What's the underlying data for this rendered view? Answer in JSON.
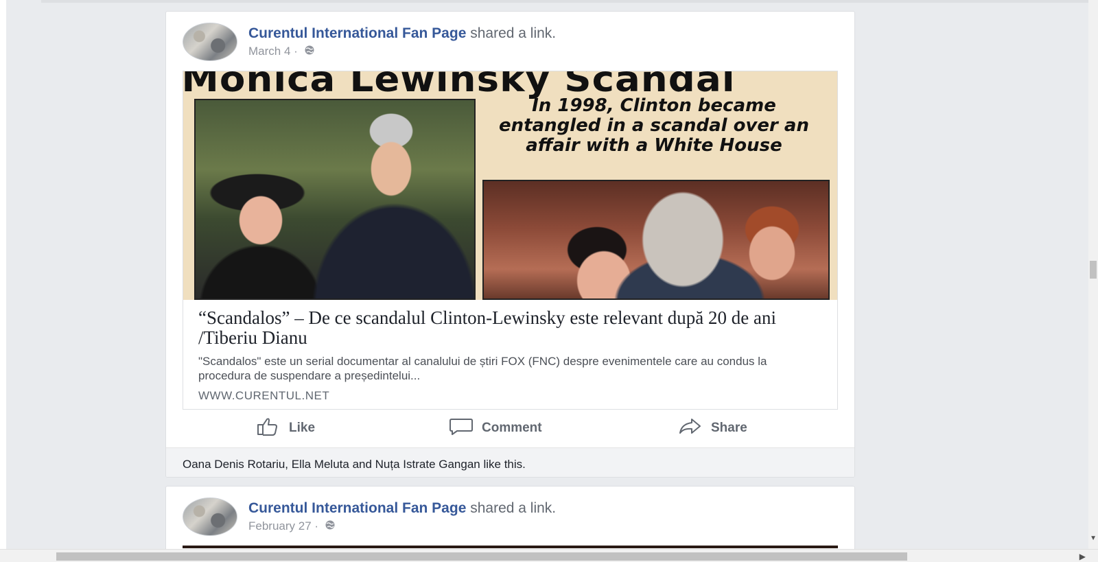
{
  "posts": [
    {
      "author": "Curentul International Fan Page",
      "action": "shared a link.",
      "date": "March 4",
      "date_separator": "·",
      "link": {
        "image_banner_title": "Monica Lewinsky Scandal",
        "image_caption": "In 1998, Clinton became entangled in a scandal over an affair with a White House",
        "headline": "“Scandalos” – De ce scandalul Clinton-Lewinsky este relevant după 20 de ani /Tiberiu Dianu",
        "description": "\"Scandalos\" este un serial documentar al canalului de știri FOX (FNC) despre evenimentele care au condus la procedura de suspendare a președintelui...",
        "domain": "WWW.CURENTUL.NET"
      },
      "actions": {
        "like": "Like",
        "comment": "Comment",
        "share": "Share"
      },
      "likes_summary": "Oana Denis Rotariu, Ella Meluta and Nuța Istrate Gangan like this."
    },
    {
      "author": "Curentul International Fan Page",
      "action": "shared a link.",
      "date": "February 27",
      "date_separator": "·"
    }
  ],
  "icons": {
    "audience": "globe-icon",
    "like": "thumbs-up-icon",
    "comment": "speech-bubble-icon",
    "share": "share-arrow-icon"
  },
  "colors": {
    "author_link": "#365899",
    "page_background": "#e9ebee",
    "action_text": "#616770"
  }
}
